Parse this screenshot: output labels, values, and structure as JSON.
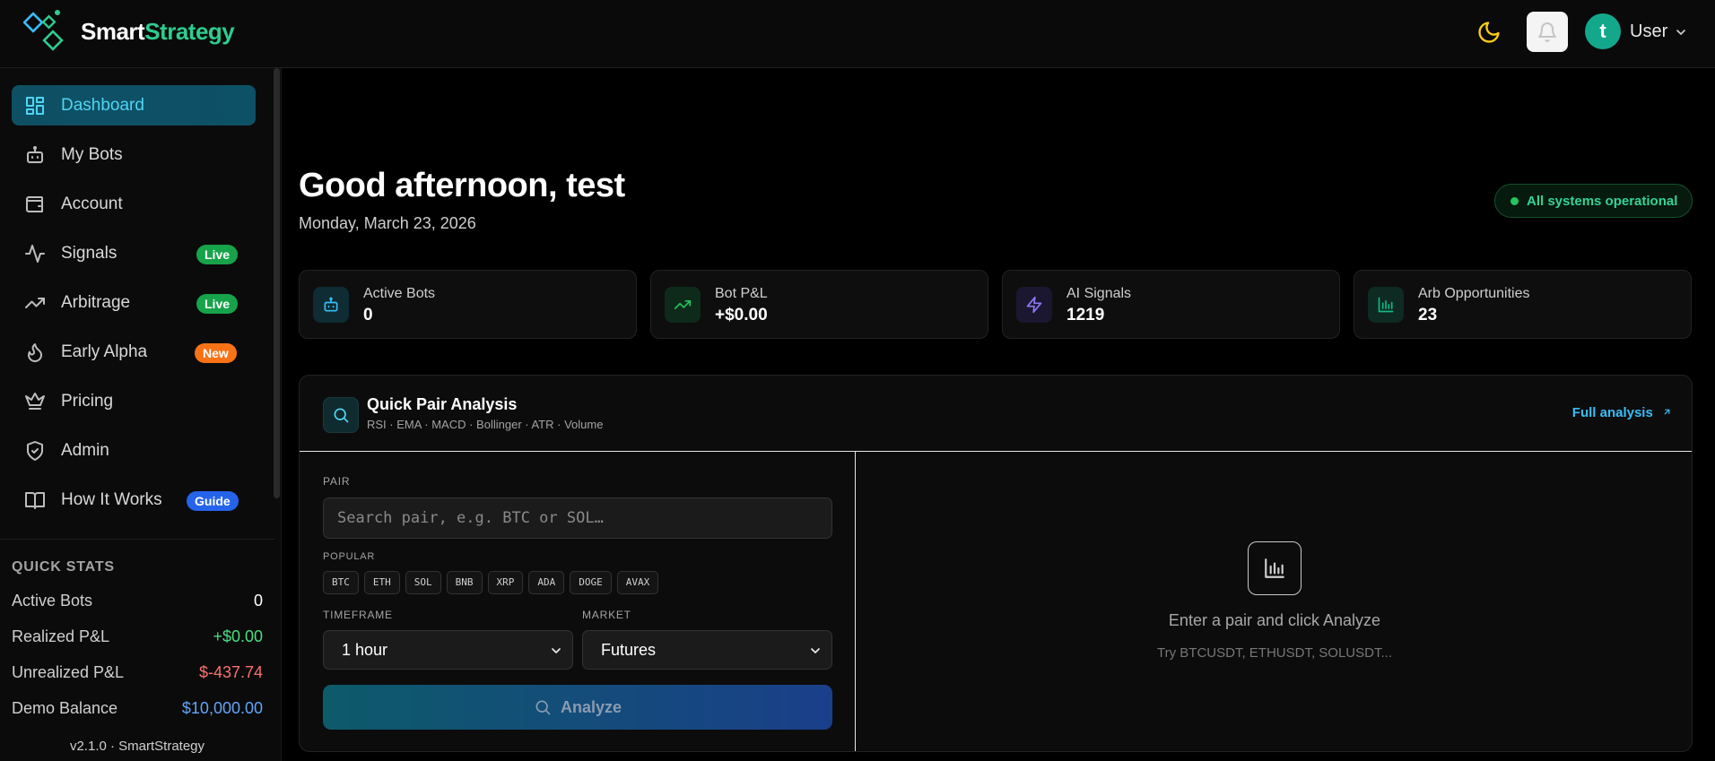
{
  "header": {
    "brand_part1": "Smart",
    "brand_part2": "Strategy",
    "user_initial": "t",
    "user_label": "User"
  },
  "sidebar": {
    "items": [
      {
        "label": "Dashboard",
        "icon": "dashboard-icon",
        "active": true
      },
      {
        "label": "My Bots",
        "icon": "bot-icon"
      },
      {
        "label": "Account",
        "icon": "wallet-icon"
      },
      {
        "label": "Signals",
        "icon": "activity-icon",
        "badge": "Live"
      },
      {
        "label": "Arbitrage",
        "icon": "trending-up-icon",
        "badge": "Live"
      },
      {
        "label": "Early Alpha",
        "icon": "flame-icon",
        "badge": "New"
      },
      {
        "label": "Pricing",
        "icon": "crown-icon"
      },
      {
        "label": "Admin",
        "icon": "shield-check-icon"
      },
      {
        "label": "How It Works",
        "icon": "book-icon",
        "badge": "Guide"
      }
    ],
    "quick_stats": {
      "title": "QUICK STATS",
      "rows": [
        {
          "label": "Active Bots",
          "value": "0"
        },
        {
          "label": "Realized P&L",
          "value": "+$0.00"
        },
        {
          "label": "Unrealized P&L",
          "value": "$-437.74"
        },
        {
          "label": "Demo Balance",
          "value": "$10,000.00"
        }
      ]
    },
    "version": "v2.1.0 · SmartStrategy"
  },
  "main": {
    "greeting": "Good afternoon, test",
    "date": "Monday, March 23, 2026",
    "status": "All systems operational",
    "stats": [
      {
        "label": "Active Bots",
        "value": "0"
      },
      {
        "label": "Bot P&L",
        "value": "+$0.00"
      },
      {
        "label": "AI Signals",
        "value": "1219"
      },
      {
        "label": "Arb Opportunities",
        "value": "23"
      }
    ],
    "analysis": {
      "title": "Quick Pair Analysis",
      "subtitle": "RSI · EMA · MACD · Bollinger · ATR · Volume",
      "full_link": "Full analysis",
      "pair_label": "PAIR",
      "search_placeholder": "Search pair, e.g. BTC or SOL…",
      "popular_label": "POPULAR",
      "popular": [
        "BTC",
        "ETH",
        "SOL",
        "BNB",
        "XRP",
        "ADA",
        "DOGE",
        "AVAX"
      ],
      "timeframe_label": "TIMEFRAME",
      "timeframe_value": "1 hour",
      "market_label": "MARKET",
      "market_value": "Futures",
      "analyze_label": "Analyze",
      "empty_text": "Enter a pair and click Analyze",
      "empty_hint": "Try BTCUSDT, ETHUSDT, SOLUSDT..."
    }
  },
  "colors": {
    "accent": "#2ecc8f",
    "active_text": "#4fd5f2",
    "positive": "#4ade80",
    "negative": "#f87171",
    "balance": "#60a5fa"
  }
}
